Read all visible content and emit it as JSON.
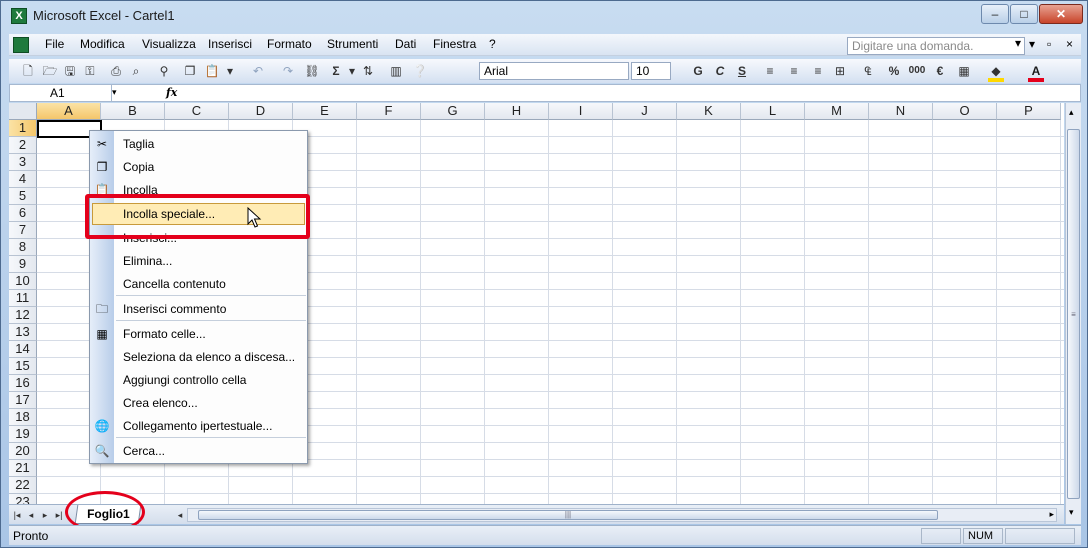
{
  "window": {
    "title": "Microsoft Excel - Cartel1",
    "app_icon": "excel-icon",
    "controls": {
      "minimize": "–",
      "maximize": "□",
      "close": "✕"
    }
  },
  "menubar": {
    "items": [
      "File",
      "Modifica",
      "Visualizza",
      "Inserisci",
      "Formato",
      "Strumenti",
      "Dati",
      "Finestra",
      "?"
    ],
    "help_placeholder": "Digitare una domanda.",
    "doc_controls": {
      "minimize": "▾",
      "restore": "▫",
      "close": "×"
    }
  },
  "toolbar": {
    "font_name": "Arial",
    "font_size": "10",
    "bold": "G",
    "italic": "C",
    "underline": "S",
    "sum": "Σ",
    "percent": "%",
    "thousands": "000",
    "currency": "€",
    "font_color_letter": "A",
    "colors": {
      "font_color": "#e4001b",
      "fill_color": "#ffd800"
    }
  },
  "formulabar": {
    "name_box": "A1",
    "fx": "fx",
    "content": ""
  },
  "grid": {
    "columns": [
      "A",
      "B",
      "C",
      "D",
      "E",
      "F",
      "G",
      "H",
      "I",
      "J",
      "K",
      "L",
      "M",
      "N",
      "O",
      "P"
    ],
    "rows": [
      "1",
      "2",
      "3",
      "4",
      "5",
      "6",
      "7",
      "8",
      "9",
      "10",
      "11",
      "12",
      "13",
      "14",
      "15",
      "16",
      "17",
      "18",
      "19",
      "20",
      "21",
      "22",
      "23"
    ],
    "active_cell": "A1"
  },
  "context_menu": {
    "items": [
      {
        "label": "Taglia",
        "icon": "scissors-icon",
        "glyph": "✂"
      },
      {
        "label": "Copia",
        "icon": "copy-icon",
        "glyph": "❐"
      },
      {
        "label": "Incolla",
        "icon": "paste-icon",
        "glyph": "📋"
      },
      {
        "label": "Incolla speciale...",
        "icon": "",
        "glyph": ""
      },
      {
        "label": "Inserisci...",
        "icon": "",
        "glyph": ""
      },
      {
        "label": "Elimina...",
        "icon": "",
        "glyph": ""
      },
      {
        "label": "Cancella contenuto",
        "icon": "",
        "glyph": ""
      },
      {
        "label": "Inserisci commento",
        "icon": "comment-icon",
        "glyph": "🗀"
      },
      {
        "label": "Formato celle...",
        "icon": "format-cells-icon",
        "glyph": "▦"
      },
      {
        "label": "Seleziona da elenco a discesa...",
        "icon": "",
        "glyph": ""
      },
      {
        "label": "Aggiungi controllo cella",
        "icon": "",
        "glyph": ""
      },
      {
        "label": "Crea elenco...",
        "icon": "",
        "glyph": ""
      },
      {
        "label": "Collegamento ipertestuale...",
        "icon": "hyperlink-icon",
        "glyph": "🌐"
      },
      {
        "label": "Cerca...",
        "icon": "search-icon",
        "glyph": "🔍"
      }
    ],
    "highlighted": "Incolla speciale..."
  },
  "sheets": {
    "tabs": [
      "Foglio1"
    ],
    "nav": [
      "|◂",
      "◂",
      "▸",
      "▸|"
    ]
  },
  "statusbar": {
    "status": "Pronto",
    "indicator": "NUM"
  },
  "annotations": {
    "highlight_color": "#e4001b"
  }
}
